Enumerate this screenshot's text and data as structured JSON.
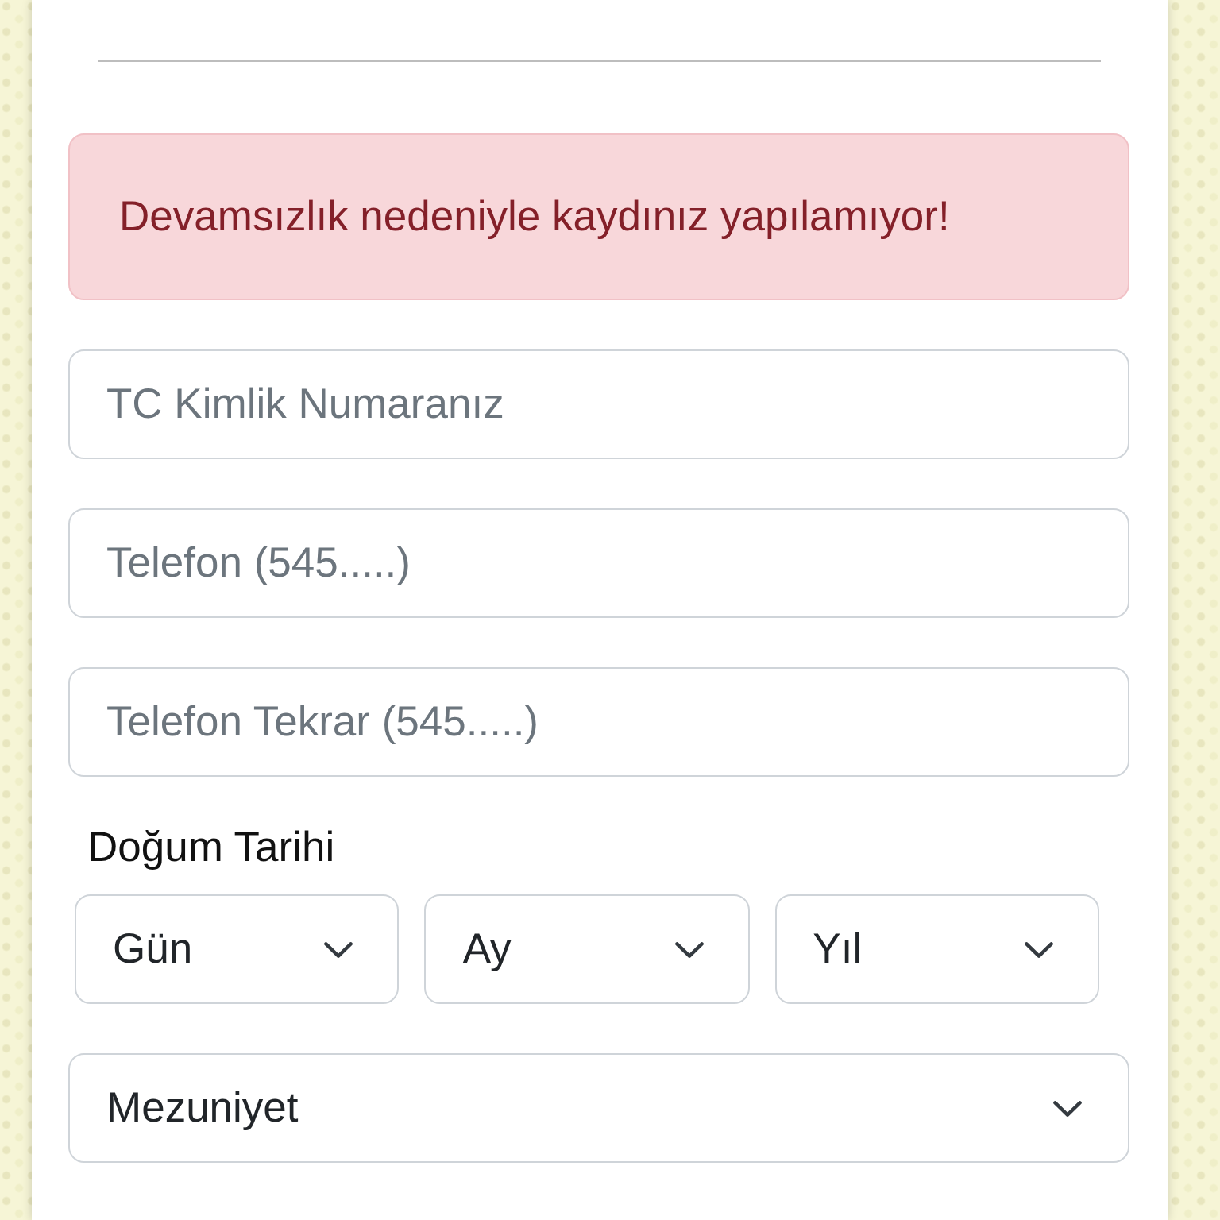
{
  "alert": {
    "text": "Devamsızlık nedeniyle kaydınız yapılamıyor!"
  },
  "fields": [
    {
      "placeholder": "TC Kimlik Numaranız"
    },
    {
      "placeholder": "Telefon (545.....)"
    },
    {
      "placeholder": "Telefon Tekrar (545.....)"
    }
  ],
  "birth_date": {
    "label": "Doğum Tarihi",
    "selects": [
      {
        "value": "Gün"
      },
      {
        "value": "Ay"
      },
      {
        "value": "Yıl"
      }
    ]
  },
  "graduation_select": {
    "value": "Mezuniyet"
  }
}
